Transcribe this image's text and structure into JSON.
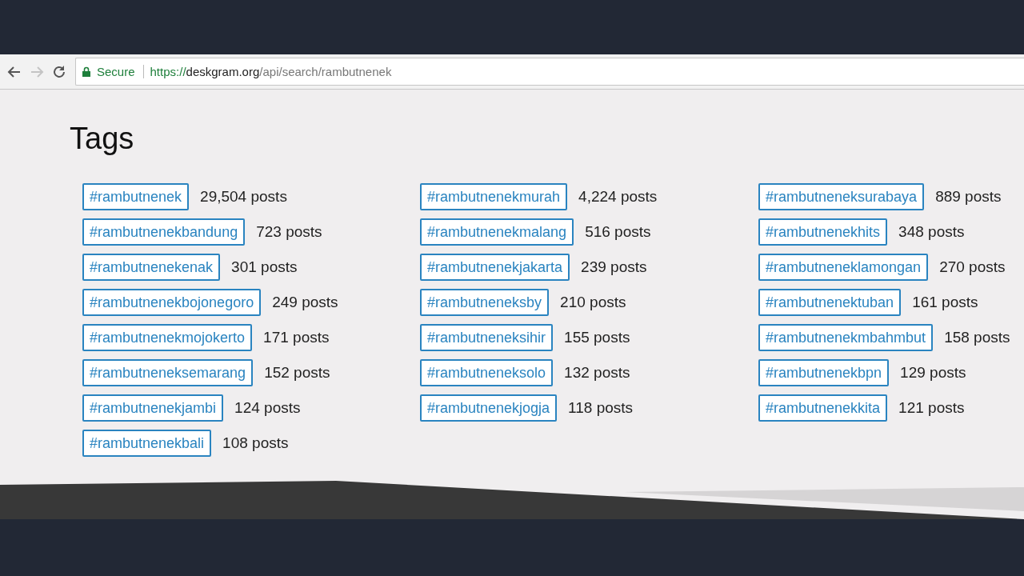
{
  "browser": {
    "secure_label": "Secure",
    "url": {
      "scheme": "https://",
      "host": "deskgram.org",
      "path": "/api/search/rambutnenek"
    }
  },
  "heading": "Tags",
  "columns": [
    [
      {
        "tag": "#rambutnenek",
        "count": "29,504 posts"
      },
      {
        "tag": "#rambutnenekbandung",
        "count": "723 posts"
      },
      {
        "tag": "#rambutnenekenak",
        "count": "301 posts"
      },
      {
        "tag": "#rambutnenekbojonegoro",
        "count": "249 posts"
      },
      {
        "tag": "#rambutnenekmojokerto",
        "count": "171 posts"
      },
      {
        "tag": "#rambutneneksemarang",
        "count": "152 posts"
      },
      {
        "tag": "#rambutnenekjambi",
        "count": "124 posts"
      },
      {
        "tag": "#rambutnenekbali",
        "count": "108 posts"
      }
    ],
    [
      {
        "tag": "#rambutnenekmurah",
        "count": "4,224 posts"
      },
      {
        "tag": "#rambutnenekmalang",
        "count": "516 posts"
      },
      {
        "tag": "#rambutnenekjakarta",
        "count": "239 posts"
      },
      {
        "tag": "#rambutneneksby",
        "count": "210 posts"
      },
      {
        "tag": "#rambutneneksihir",
        "count": "155 posts"
      },
      {
        "tag": "#rambutneneksolo",
        "count": "132 posts"
      },
      {
        "tag": "#rambutnenekjogja",
        "count": "118 posts"
      }
    ],
    [
      {
        "tag": "#rambutneneksurabaya",
        "count": "889 posts"
      },
      {
        "tag": "#rambutnenekhits",
        "count": "348 posts"
      },
      {
        "tag": "#rambutneneklamongan",
        "count": "270 posts"
      },
      {
        "tag": "#rambutnenektuban",
        "count": "161 posts"
      },
      {
        "tag": "#rambutnenekmbahmbut",
        "count": "158 posts"
      },
      {
        "tag": "#rambutnenekbpn",
        "count": "129 posts"
      },
      {
        "tag": "#rambutnenekkita",
        "count": "121 posts"
      }
    ]
  ]
}
